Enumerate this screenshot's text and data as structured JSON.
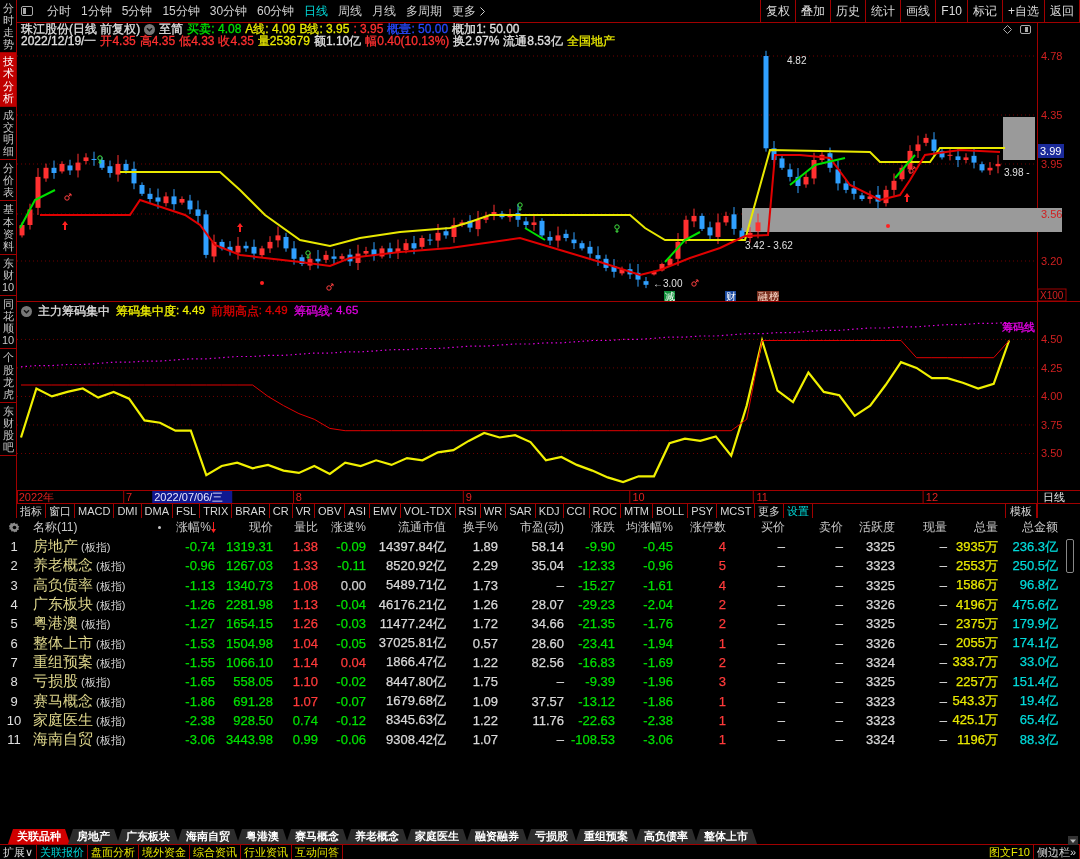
{
  "sidebar": {
    "tabs": [
      {
        "label": "分时走势",
        "selected": false
      },
      {
        "label": "技术分析",
        "selected": true
      },
      {
        "label": "成交明细",
        "selected": false
      },
      {
        "label": "分价表",
        "selected": false
      },
      {
        "label": "基本资料",
        "selected": false
      },
      {
        "label": "东财10",
        "selected": false
      },
      {
        "label": "同花顺10",
        "selected": false
      },
      {
        "label": "个股龙虎",
        "selected": false
      },
      {
        "label": "东财股吧",
        "selected": false
      }
    ]
  },
  "toolbar": {
    "periods": [
      {
        "label": "分时",
        "selected": false
      },
      {
        "label": "1分钟",
        "selected": false
      },
      {
        "label": "5分钟",
        "selected": false
      },
      {
        "label": "15分钟",
        "selected": false
      },
      {
        "label": "30分钟",
        "selected": false
      },
      {
        "label": "60分钟",
        "selected": false
      },
      {
        "label": "日线",
        "selected": true
      },
      {
        "label": "周线",
        "selected": false
      },
      {
        "label": "月线",
        "selected": false
      },
      {
        "label": "多周期",
        "selected": false
      }
    ],
    "more": "更多",
    "buttons": [
      "复权",
      "叠加",
      "历史",
      "统计",
      "画线",
      "F10",
      "标记",
      "+自选",
      "返回"
    ]
  },
  "quote": {
    "title": "珠江股份(日线 前复权)",
    "mode": "至简",
    "indicators": [
      {
        "text": "买卖: 4.08",
        "color": "#00e000"
      },
      {
        "text": "A线: 4.09",
        "color": "#e8e800"
      },
      {
        "text": "B线: 3.95",
        "color": "#e8e800"
      },
      {
        "text": ": 3.95",
        "color": "#ff3030"
      },
      {
        "text": "概壹: 50.00",
        "color": "#2848ff"
      },
      {
        "text": "概加1: 50.00",
        "color": "#e0e0e0"
      }
    ],
    "bar_info": [
      {
        "text": "2022/12/19/一",
        "color": "#e0e0e0"
      },
      {
        "text": "开4.35",
        "color": "#ff3030"
      },
      {
        "text": "高4.35",
        "color": "#ff3030"
      },
      {
        "text": "低4.33",
        "color": "#ff3030"
      },
      {
        "text": "收4.35",
        "color": "#ff3030"
      },
      {
        "text": "量253679",
        "color": "#e8e800"
      },
      {
        "text": "额1.10亿",
        "color": "#e0e0e0"
      },
      {
        "text": "幅0.40(10.13%)",
        "color": "#ff3030"
      },
      {
        "text": "换2.97%",
        "color": "#e0e0e0"
      },
      {
        "text": "流通8.53亿",
        "color": "#e0e0e0"
      },
      {
        "text": "全国地产",
        "color": "#e8e800"
      }
    ]
  },
  "main_chart": {
    "price_axis": [
      {
        "text": "4.78",
        "kind": "tick"
      },
      {
        "text": "4.35",
        "kind": "tick"
      },
      {
        "text": "3.99",
        "kind": "current"
      },
      {
        "text": "3.95",
        "kind": "tick"
      },
      {
        "text": "3.56",
        "kind": "tick"
      },
      {
        "text": "3.20",
        "kind": "tick"
      }
    ],
    "annotations": [
      {
        "text": "4.82"
      },
      {
        "text": "3.42 - 3.62"
      },
      {
        "text": "3.98 -"
      },
      {
        "text": "←3.00"
      }
    ],
    "events": [
      {
        "label": "减",
        "kind": "reduce"
      },
      {
        "label": "财",
        "kind": "report"
      },
      {
        "label": "融",
        "kind": "margin"
      },
      {
        "label": "榜",
        "kind": "ranking"
      }
    ],
    "scale": "X100"
  },
  "indicator_panel": {
    "title": "主力筹码集中",
    "legend_values": [
      ": 4.49",
      ": 4.49",
      ": 4.65"
    ],
    "end_labels": [
      {
        "text": "筹码线",
        "color": "#e000e0"
      }
    ],
    "period": "日线",
    "chart_data": {
      "type": "line",
      "grid": true,
      "categories": [
        null,
        "2022年",
        null,
        null,
        null,
        null,
        null,
        "7",
        null,
        null,
        null,
        null,
        null,
        null,
        null,
        null,
        null,
        null,
        "8",
        null,
        null,
        null,
        null,
        null,
        null,
        null,
        null,
        null,
        null,
        "9",
        null,
        null,
        null,
        null,
        null,
        null,
        null,
        null,
        null,
        null,
        "10",
        null,
        null,
        null,
        null,
        null,
        null,
        null,
        "11",
        null,
        null,
        null,
        null,
        null,
        null,
        null,
        null,
        null,
        null,
        "12",
        null,
        null,
        null,
        null,
        null
      ],
      "ylim": [
        3.18,
        4.67
      ],
      "yticks": [
        {
          "value": 4.5,
          "label": "4.50"
        },
        {
          "value": 4.25,
          "label": "4.25"
        },
        {
          "value": 4.0,
          "label": "4.00"
        },
        {
          "value": 3.75,
          "label": "3.75"
        },
        {
          "value": 3.5,
          "label": "3.50"
        }
      ],
      "annotations": [
        "2022/07/06/三"
      ],
      "series": [
        {
          "name": "筹码集中度",
          "color": "#f0f000",
          "line_style": "solid",
          "values": [
            3.64,
            4.07,
            4.0,
            4.04,
            4.07,
            3.99,
            4.04,
            3.98,
            3.79,
            3.77,
            3.7,
            3.7,
            3.31,
            3.39,
            3.42,
            3.37,
            3.4,
            3.35,
            3.33,
            3.39,
            3.32,
            3.42,
            3.39,
            3.44,
            3.4,
            3.46,
            3.44,
            3.51,
            3.53,
            3.61,
            3.68,
            3.64,
            3.66,
            3.6,
            3.44,
            3.47,
            3.4,
            3.35,
            3.29,
            3.25,
            3.3,
            3.3,
            3.59,
            3.63,
            3.61,
            3.65,
            3.48,
            3.92,
            4.49,
            4.05,
            3.95,
            4.21,
            4.04,
            4.01,
            3.83,
            3.92,
            4.1,
            4.3,
            4.25,
            4.16,
            4.16,
            4.12,
            4.07,
            4.11,
            4.49
          ]
        },
        {
          "name": "前期高点",
          "color": "#e00000",
          "line_style": "solid",
          "values": [
            4.1,
            4.1,
            4.1,
            4.1,
            4.1,
            4.1,
            4.1,
            4.1,
            4.1,
            4.1,
            4.1,
            4.1,
            4.1,
            4.1,
            4.1,
            4.1,
            4.0,
            3.92,
            3.85,
            3.8,
            3.72,
            3.7,
            3.7,
            3.7,
            3.7,
            3.7,
            3.7,
            3.7,
            3.7,
            3.7,
            3.7,
            3.7,
            3.7,
            3.7,
            3.7,
            3.7,
            3.7,
            3.7,
            3.7,
            3.7,
            3.7,
            3.7,
            3.7,
            3.7,
            3.7,
            3.7,
            3.7,
            3.8,
            4.49,
            4.49,
            4.49,
            4.49,
            4.49,
            4.49,
            4.49,
            4.49,
            4.49,
            4.49,
            4.34,
            4.34,
            4.34,
            4.34,
            4.34,
            4.34,
            4.49
          ]
        },
        {
          "name": "筹码线",
          "color": "#e000e0",
          "line_style": "dotted",
          "values": [
            4.26,
            4.27,
            4.27,
            4.28,
            4.28,
            4.29,
            4.3,
            4.3,
            4.31,
            4.31,
            4.32,
            4.33,
            4.33,
            4.34,
            4.35,
            4.35,
            4.36,
            4.36,
            4.37,
            4.38,
            4.38,
            4.39,
            4.39,
            4.4,
            4.41,
            4.41,
            4.42,
            4.42,
            4.43,
            4.44,
            4.44,
            4.45,
            4.46,
            4.46,
            4.47,
            4.47,
            4.48,
            4.49,
            4.49,
            4.5,
            4.5,
            4.51,
            4.52,
            4.52,
            4.53,
            4.53,
            4.54,
            4.55,
            4.55,
            4.56,
            4.56,
            4.57,
            4.58,
            4.58,
            4.59,
            4.6,
            4.6,
            4.61,
            4.61,
            4.62,
            4.63,
            4.63,
            4.64,
            4.64,
            4.65
          ]
        }
      ]
    }
  },
  "indicator_tabs": {
    "tabs": [
      {
        "label": "指标",
        "kind": "tab"
      },
      {
        "label": "窗口",
        "kind": "tab"
      },
      {
        "label": "MACD",
        "kind": "tab"
      },
      {
        "label": "DMI",
        "kind": "tab"
      },
      {
        "label": "DMA",
        "kind": "tab"
      },
      {
        "label": "FSL",
        "kind": "tab"
      },
      {
        "label": "TRIX",
        "kind": "tab"
      },
      {
        "label": "BRAR",
        "kind": "tab"
      },
      {
        "label": "CR",
        "kind": "tab"
      },
      {
        "label": "VR",
        "kind": "tab"
      },
      {
        "label": "OBV",
        "kind": "tab"
      },
      {
        "label": "ASI",
        "kind": "tab"
      },
      {
        "label": "EMV",
        "kind": "tab"
      },
      {
        "label": "VOL-TDX",
        "kind": "tab"
      },
      {
        "label": "RSI",
        "kind": "tab"
      },
      {
        "label": "WR",
        "kind": "tab"
      },
      {
        "label": "SAR",
        "kind": "tab"
      },
      {
        "label": "KDJ",
        "kind": "tab"
      },
      {
        "label": "CCI",
        "kind": "tab"
      },
      {
        "label": "ROC",
        "kind": "tab"
      },
      {
        "label": "MTM",
        "kind": "tab"
      },
      {
        "label": "BOLL",
        "kind": "tab"
      },
      {
        "label": "PSY",
        "kind": "tab"
      },
      {
        "label": "MCST",
        "kind": "tab"
      },
      {
        "label": "更多",
        "kind": "tab"
      },
      {
        "label": "设置",
        "kind": "settings"
      }
    ],
    "template": "模板"
  },
  "table": {
    "columns": [
      {
        "kind": "settings"
      },
      {
        "kind": "name",
        "label": "名称(11)",
        "sorted": false
      },
      {
        "kind": "marker"
      },
      {
        "kind": "number",
        "label": "涨幅%",
        "sorted": true
      },
      {
        "kind": "number",
        "label": "现价",
        "sorted": false
      },
      {
        "kind": "number",
        "label": "量比",
        "sorted": false
      },
      {
        "kind": "number",
        "label": "涨速%",
        "sorted": false
      },
      {
        "kind": "number",
        "label": "流通市值",
        "sorted": false
      },
      {
        "kind": "number",
        "label": "换手%",
        "sorted": false
      },
      {
        "kind": "number",
        "label": "市盈(动)",
        "sorted": false
      },
      {
        "kind": "number",
        "label": "涨跌",
        "sorted": false
      },
      {
        "kind": "number",
        "label": "均涨幅%",
        "sorted": false
      },
      {
        "kind": "number",
        "label": "涨停数",
        "sorted": false
      },
      {
        "kind": "number",
        "label": "买价",
        "sorted": false
      },
      {
        "kind": "number",
        "label": "卖价",
        "sorted": false
      },
      {
        "kind": "number",
        "label": "活跃度",
        "sorted": false
      },
      {
        "kind": "number",
        "label": "现量",
        "sorted": false
      },
      {
        "kind": "number",
        "label": "总量",
        "sorted": false
      },
      {
        "kind": "number",
        "label": "总金额",
        "sorted": false
      }
    ],
    "rows": [
      {
        "cells": [
          "1",
          {
            "text": "房地产",
            "tag": "(板指)"
          },
          null,
          {
            "text": "-0.74",
            "color": "#00e000"
          },
          {
            "text": "1319.31",
            "color": "#00e000"
          },
          {
            "text": "1.38",
            "color": "#ff3b3b"
          },
          {
            "text": "-0.09",
            "color": "#00e000"
          },
          "14397.84亿",
          "1.89",
          "58.14",
          {
            "text": "-9.90",
            "color": "#00e000"
          },
          {
            "text": "-0.45",
            "color": "#00e000"
          },
          "4",
          "–",
          "–",
          "3325",
          "–",
          "3935万",
          "236.3亿"
        ]
      },
      {
        "cells": [
          "2",
          {
            "text": "养老概念",
            "tag": "(板指)"
          },
          null,
          {
            "text": "-0.96",
            "color": "#00e000"
          },
          {
            "text": "1267.03",
            "color": "#00e000"
          },
          {
            "text": "1.33",
            "color": "#ff3b3b"
          },
          {
            "text": "-0.11",
            "color": "#00e000"
          },
          "8520.92亿",
          "2.29",
          "35.04",
          {
            "text": "-12.33",
            "color": "#00e000"
          },
          {
            "text": "-0.96",
            "color": "#00e000"
          },
          "5",
          "–",
          "–",
          "3323",
          "–",
          "2553万",
          "250.5亿"
        ]
      },
      {
        "cells": [
          "3",
          {
            "text": "高负债率",
            "tag": "(板指)"
          },
          null,
          {
            "text": "-1.13",
            "color": "#00e000"
          },
          {
            "text": "1340.73",
            "color": "#00e000"
          },
          {
            "text": "1.08",
            "color": "#ff3b3b"
          },
          {
            "text": "0.00",
            "color": "#d0d0d0"
          },
          "5489.71亿",
          "1.73",
          "–",
          {
            "text": "-15.27",
            "color": "#00e000"
          },
          {
            "text": "-1.61",
            "color": "#00e000"
          },
          "4",
          "–",
          "–",
          "3325",
          "–",
          "1586万",
          "96.8亿"
        ]
      },
      {
        "cells": [
          "4",
          {
            "text": "广东板块",
            "tag": "(板指)"
          },
          null,
          {
            "text": "-1.26",
            "color": "#00e000"
          },
          {
            "text": "2281.98",
            "color": "#00e000"
          },
          {
            "text": "1.13",
            "color": "#ff3b3b"
          },
          {
            "text": "-0.04",
            "color": "#00e000"
          },
          "46176.21亿",
          "1.26",
          "28.07",
          {
            "text": "-29.23",
            "color": "#00e000"
          },
          {
            "text": "-2.04",
            "color": "#00e000"
          },
          "2",
          "–",
          "–",
          "3326",
          "–",
          "4196万",
          "475.6亿"
        ]
      },
      {
        "cells": [
          "5",
          {
            "text": "粤港澳",
            "tag": "(板指)"
          },
          null,
          {
            "text": "-1.27",
            "color": "#00e000"
          },
          {
            "text": "1654.15",
            "color": "#00e000"
          },
          {
            "text": "1.26",
            "color": "#ff3b3b"
          },
          {
            "text": "-0.03",
            "color": "#00e000"
          },
          "11477.24亿",
          "1.72",
          "34.66",
          {
            "text": "-21.35",
            "color": "#00e000"
          },
          {
            "text": "-1.76",
            "color": "#00e000"
          },
          "2",
          "–",
          "–",
          "3325",
          "–",
          "2375万",
          "179.9亿"
        ]
      },
      {
        "cells": [
          "6",
          {
            "text": "整体上市",
            "tag": "(板指)"
          },
          null,
          {
            "text": "-1.53",
            "color": "#00e000"
          },
          {
            "text": "1504.98",
            "color": "#00e000"
          },
          {
            "text": "1.04",
            "color": "#ff3b3b"
          },
          {
            "text": "-0.05",
            "color": "#00e000"
          },
          "37025.81亿",
          "0.57",
          "28.60",
          {
            "text": "-23.41",
            "color": "#00e000"
          },
          {
            "text": "-1.94",
            "color": "#00e000"
          },
          "1",
          "–",
          "–",
          "3326",
          "–",
          "2055万",
          "174.1亿"
        ]
      },
      {
        "cells": [
          "7",
          {
            "text": "重组预案",
            "tag": "(板指)"
          },
          null,
          {
            "text": "-1.55",
            "color": "#00e000"
          },
          {
            "text": "1066.10",
            "color": "#00e000"
          },
          {
            "text": "1.14",
            "color": "#ff3b3b"
          },
          {
            "text": "0.04",
            "color": "#ff3b3b"
          },
          "1866.47亿",
          "1.22",
          "82.56",
          {
            "text": "-16.83",
            "color": "#00e000"
          },
          {
            "text": "-1.69",
            "color": "#00e000"
          },
          "2",
          "–",
          "–",
          "3324",
          "–",
          "333.7万",
          "33.0亿"
        ]
      },
      {
        "cells": [
          "8",
          {
            "text": "亏损股",
            "tag": "(板指)"
          },
          null,
          {
            "text": "-1.65",
            "color": "#00e000"
          },
          {
            "text": "558.05",
            "color": "#00e000"
          },
          {
            "text": "1.10",
            "color": "#ff3b3b"
          },
          {
            "text": "-0.02",
            "color": "#00e000"
          },
          "8447.80亿",
          "1.75",
          "–",
          {
            "text": "-9.39",
            "color": "#00e000"
          },
          {
            "text": "-1.96",
            "color": "#00e000"
          },
          "3",
          "–",
          "–",
          "3325",
          "–",
          "2257万",
          "151.4亿"
        ]
      },
      {
        "cells": [
          "9",
          {
            "text": "赛马概念",
            "tag": "(板指)"
          },
          null,
          {
            "text": "-1.86",
            "color": "#00e000"
          },
          {
            "text": "691.28",
            "color": "#00e000"
          },
          {
            "text": "1.07",
            "color": "#ff3b3b"
          },
          {
            "text": "-0.07",
            "color": "#00e000"
          },
          "1679.68亿",
          "1.09",
          "37.57",
          {
            "text": "-13.12",
            "color": "#00e000"
          },
          {
            "text": "-1.86",
            "color": "#00e000"
          },
          "1",
          "–",
          "–",
          "3323",
          "–",
          "543.3万",
          "19.4亿"
        ]
      },
      {
        "cells": [
          "10",
          {
            "text": "家庭医生",
            "tag": "(板指)"
          },
          null,
          {
            "text": "-2.38",
            "color": "#00e000"
          },
          {
            "text": "928.50",
            "color": "#00e000"
          },
          {
            "text": "0.74",
            "color": "#00e000"
          },
          {
            "text": "-0.12",
            "color": "#00e000"
          },
          "8345.63亿",
          "1.22",
          "11.76",
          {
            "text": "-22.63",
            "color": "#00e000"
          },
          {
            "text": "-2.38",
            "color": "#00e000"
          },
          "1",
          "–",
          "–",
          "3323",
          "–",
          "425.1万",
          "65.4亿"
        ]
      },
      {
        "cells": [
          "11",
          {
            "text": "海南自贸",
            "tag": "(板指)"
          },
          null,
          {
            "text": "-3.06",
            "color": "#00e000"
          },
          {
            "text": "3443.98",
            "color": "#00e000"
          },
          {
            "text": "0.99",
            "color": "#00e000"
          },
          {
            "text": "-0.06",
            "color": "#00e000"
          },
          "9308.42亿",
          "1.07",
          "–",
          {
            "text": "-108.53",
            "color": "#00e000"
          },
          {
            "text": "-3.06",
            "color": "#00e000"
          },
          "1",
          "–",
          "–",
          "3324",
          "–",
          "1196万",
          "88.3亿"
        ]
      }
    ]
  },
  "sheet_tabs": [
    {
      "label": "关联品种",
      "selected": true
    },
    {
      "label": "房地产",
      "selected": false
    },
    {
      "label": "广东板块",
      "selected": false
    },
    {
      "label": "海南自贸",
      "selected": false
    },
    {
      "label": "粤港澳",
      "selected": false
    },
    {
      "label": "赛马概念",
      "selected": false
    },
    {
      "label": "养老概念",
      "selected": false
    },
    {
      "label": "家庭医生",
      "selected": false
    },
    {
      "label": "融资融券",
      "selected": false
    },
    {
      "label": "亏损股",
      "selected": false
    },
    {
      "label": "重组预案",
      "selected": false
    },
    {
      "label": "高负债率",
      "selected": false
    },
    {
      "label": "整体上市",
      "selected": false
    }
  ],
  "bottom_bar": {
    "menu": "扩展∨",
    "tabs": [
      {
        "label": "关联报价",
        "selected": true
      },
      {
        "label": "盘面分析",
        "selected": false
      },
      {
        "label": "境外资金",
        "selected": false
      },
      {
        "label": "综合资讯",
        "selected": false
      },
      {
        "label": "行业资讯",
        "selected": false
      },
      {
        "label": "互动问答",
        "selected": false
      }
    ],
    "buttons": [
      {
        "label": "图文F10",
        "kind": "f10"
      },
      {
        "label": "侧边栏»",
        "kind": "sidebar"
      }
    ]
  }
}
